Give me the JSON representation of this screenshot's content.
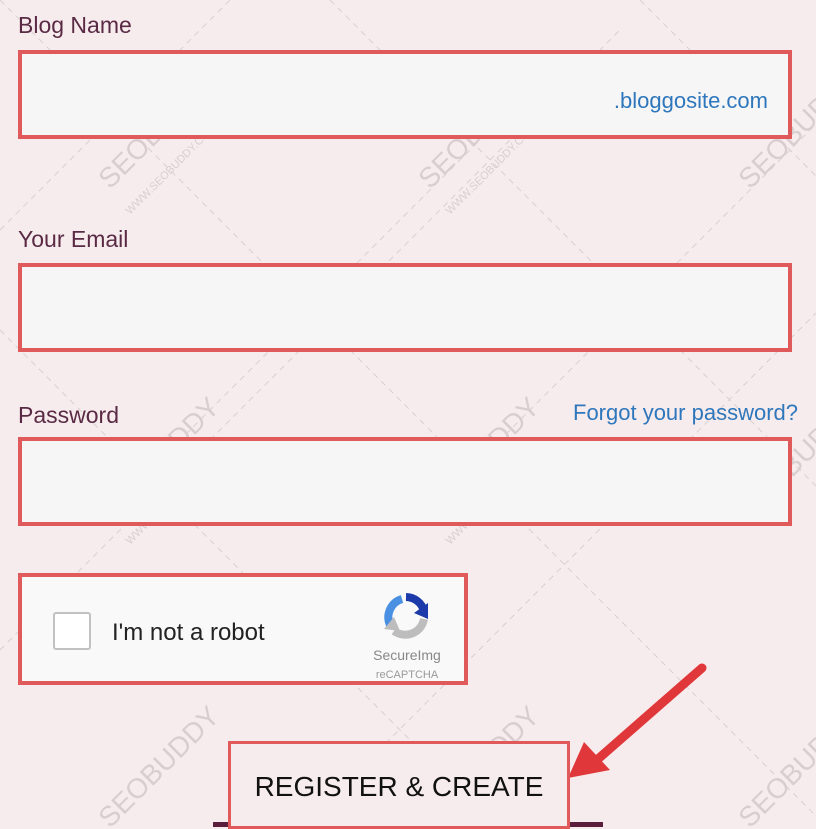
{
  "form": {
    "blog_name": {
      "label": "Blog Name",
      "suffix": ".bloggosite.com",
      "value": ""
    },
    "email": {
      "label": "Your Email",
      "value": ""
    },
    "password": {
      "label": "Password",
      "value": "",
      "forgot_link": "Forgot your password?"
    },
    "captcha": {
      "checkbox_label": "I'm not a robot",
      "brand": "SecureImg",
      "sub": "reCAPTCHA"
    },
    "submit_label": "REGISTER & CREATE"
  },
  "watermark": {
    "text": "SEOBUDDY",
    "url": "WWW.SEOBUDDY.COM"
  },
  "colors": {
    "background": "#f7eced",
    "highlight_border": "#e05a5c",
    "label": "#5a2a45",
    "link": "#2f77bc",
    "underline": "#5a1e3c"
  },
  "icons": [
    "recaptcha-icon",
    "annotation-arrow-icon"
  ]
}
